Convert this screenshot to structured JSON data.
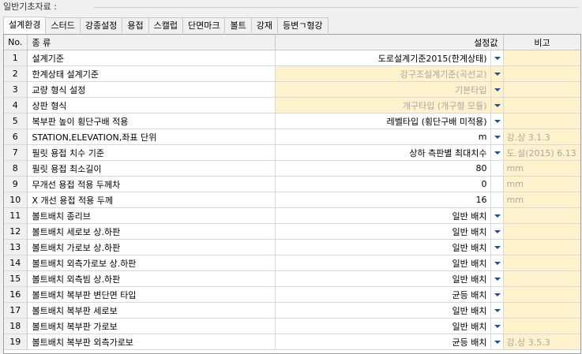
{
  "group_title": "일반기초자료 :",
  "tabs": [
    {
      "label": "설계환경",
      "active": true
    },
    {
      "label": "스터드",
      "active": false
    },
    {
      "label": "강종설정",
      "active": false
    },
    {
      "label": "용접",
      "active": false
    },
    {
      "label": "스캘럽",
      "active": false
    },
    {
      "label": "단면마크",
      "active": false
    },
    {
      "label": "볼트",
      "active": false
    },
    {
      "label": "강재",
      "active": false
    },
    {
      "label": "등변ㄱ형강",
      "active": false
    }
  ],
  "grid": {
    "headers": {
      "no": "No.",
      "name": "종 류",
      "value": "설정값",
      "note": "비고"
    },
    "rows": [
      {
        "no": "1",
        "name": "설계기준",
        "value": "도로설계기준2015(한계상태)",
        "dropdown": true,
        "readonly": false,
        "note": ""
      },
      {
        "no": "2",
        "name": "한계상태 설계기준",
        "value": "강구조설계기준(곡선교)",
        "dropdown": true,
        "readonly": true,
        "note": ""
      },
      {
        "no": "3",
        "name": "교량 형식 설정",
        "value": "기본타입",
        "dropdown": true,
        "readonly": true,
        "note": ""
      },
      {
        "no": "4",
        "name": "상판 형식",
        "value": "개구타입 (개구형 모듈)",
        "dropdown": true,
        "readonly": true,
        "note": ""
      },
      {
        "no": "5",
        "name": "복부판 높이 횡단구배 적용",
        "value": "레벨타입 (횡단구배 미적용)",
        "dropdown": true,
        "readonly": false,
        "note": ""
      },
      {
        "no": "6",
        "name": "STATION,ELEVATION,좌표 단위",
        "value": "m",
        "dropdown": true,
        "readonly": false,
        "note": "강.상 3.1.3"
      },
      {
        "no": "7",
        "name": "필릿 용접 치수 기준",
        "value": "상하 측판별 최대치수",
        "dropdown": true,
        "readonly": false,
        "note": "도.설(2015) 6.13"
      },
      {
        "no": "8",
        "name": "필릿 용접 최소길이",
        "value": "80",
        "dropdown": false,
        "readonly": false,
        "note": "mm"
      },
      {
        "no": "9",
        "name": "무개선 용접 적용 두께차",
        "value": "0",
        "dropdown": false,
        "readonly": false,
        "note": "mm"
      },
      {
        "no": "10",
        "name": "X 개선 용접 적용 두께",
        "value": "16",
        "dropdown": false,
        "readonly": false,
        "note": "mm"
      },
      {
        "no": "11",
        "name": "볼트배치 종리브",
        "value": "일반 배치",
        "dropdown": true,
        "readonly": false,
        "note": ""
      },
      {
        "no": "12",
        "name": "볼트배치 세로보 상.하판",
        "value": "일반 배치",
        "dropdown": true,
        "readonly": false,
        "note": ""
      },
      {
        "no": "13",
        "name": "볼트배치 가로보 상.하판",
        "value": "일반 배치",
        "dropdown": true,
        "readonly": false,
        "note": ""
      },
      {
        "no": "14",
        "name": "볼트배치 외측가로보 상.하판",
        "value": "일반 배치",
        "dropdown": true,
        "readonly": false,
        "note": ""
      },
      {
        "no": "15",
        "name": "볼트배치 외측빔 상.하판",
        "value": "일반 배치",
        "dropdown": true,
        "readonly": false,
        "note": ""
      },
      {
        "no": "16",
        "name": "볼트배치 복부판 변단면 타입",
        "value": "균등 배치",
        "dropdown": true,
        "readonly": false,
        "note": ""
      },
      {
        "no": "17",
        "name": "볼트배치 복부판 세로보",
        "value": "일반 배치",
        "dropdown": true,
        "readonly": false,
        "note": ""
      },
      {
        "no": "18",
        "name": "볼트배치 복부판 가로보",
        "value": "일반 배치",
        "dropdown": true,
        "readonly": false,
        "note": ""
      },
      {
        "no": "19",
        "name": "볼트배치 복부판 외측가로보",
        "value": "균등 배치",
        "dropdown": true,
        "readonly": false,
        "note": "강.상 3.5.3"
      }
    ]
  },
  "colors": {
    "readonly_bg": "#fdf2cc",
    "dropdown_arrow": "#1f4f9c",
    "header_bg": "#f0f0f0"
  }
}
